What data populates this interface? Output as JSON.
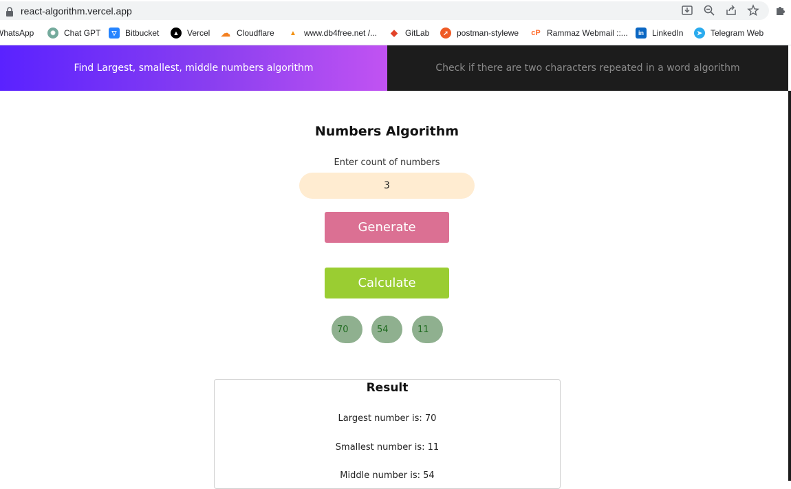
{
  "browser": {
    "url": "react-algorithm.vercel.app",
    "bookmarks": [
      {
        "label": "WhatsApp",
        "icon": "whatsapp-icon"
      },
      {
        "label": "Chat GPT",
        "icon": "chatgpt-icon"
      },
      {
        "label": "Bitbucket",
        "icon": "bitbucket-icon"
      },
      {
        "label": "Vercel",
        "icon": "vercel-icon"
      },
      {
        "label": "Cloudflare",
        "icon": "cloudflare-icon"
      },
      {
        "label": "www.db4free.net /...",
        "icon": "phpmyadmin-icon"
      },
      {
        "label": "GitLab",
        "icon": "gitlab-icon"
      },
      {
        "label": "postman-stylewe",
        "icon": "postman-icon"
      },
      {
        "label": "Rammaz Webmail ::...",
        "icon": "cpanel-icon"
      },
      {
        "label": "LinkedIn",
        "icon": "linkedin-icon"
      },
      {
        "label": "Telegram Web",
        "icon": "telegram-icon"
      }
    ]
  },
  "tabs": [
    {
      "label": "Find Largest, smallest, middle numbers algorithm",
      "active": true
    },
    {
      "label": "Check if there are two characters repeated in a word algorithm",
      "active": false
    }
  ],
  "main": {
    "title": "Numbers Algorithm",
    "count_label": "Enter count of numbers",
    "count_value": "3",
    "generate_label": "Generate",
    "calculate_label": "Calculate",
    "numbers": [
      "70",
      "54",
      "11"
    ]
  },
  "result": {
    "title": "Result",
    "largest": "Largest number is: 70",
    "smallest": "Smallest number is: 11",
    "middle": "Middle number is: 54"
  },
  "colors": {
    "tab_gradient_start": "#5a22ff",
    "tab_gradient_end": "#c153f2",
    "tab_inactive_bg": "#1c1c1c",
    "input_bg": "#ffecd1",
    "generate_bg": "#db7093",
    "calculate_bg": "#9acd32",
    "chip_bg": "#8fb08f"
  }
}
